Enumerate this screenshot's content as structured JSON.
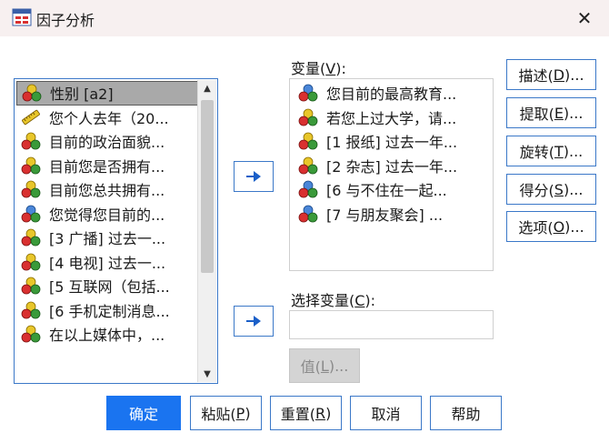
{
  "window": {
    "title": "因子分析",
    "close_symbol": "✕"
  },
  "source_list": {
    "items": [
      {
        "label": "性别 [a2]",
        "icon": "nominal-variable-icon",
        "selected": true
      },
      {
        "label": "您个人去年（20...",
        "icon": "scale-variable-icon",
        "selected": false
      },
      {
        "label": "目前的政治面貌...",
        "icon": "nominal-variable-icon",
        "selected": false
      },
      {
        "label": "目前您是否拥有...",
        "icon": "nominal-variable-icon",
        "selected": false
      },
      {
        "label": "目前您总共拥有...",
        "icon": "nominal-variable-icon",
        "selected": false
      },
      {
        "label": "您觉得您目前的...",
        "icon": "ordinal-variable-icon",
        "selected": false
      },
      {
        "label": "[3 广播]  过去一...",
        "icon": "nominal-variable-icon",
        "selected": false
      },
      {
        "label": "[4 电视]  过去一...",
        "icon": "nominal-variable-icon",
        "selected": false
      },
      {
        "label": "[5 互联网（包括...",
        "icon": "nominal-variable-icon",
        "selected": false
      },
      {
        "label": "[6 手机定制消息...",
        "icon": "nominal-variable-icon",
        "selected": false
      },
      {
        "label": "在以上媒体中，...",
        "icon": "nominal-variable-icon",
        "selected": false
      }
    ]
  },
  "variables": {
    "label_prefix": "变量(",
    "label_key": "V",
    "label_suffix": "):",
    "items": [
      {
        "label": "您目前的最高教育...",
        "icon": "ordinal-variable-icon"
      },
      {
        "label": "若您上过大学，请...",
        "icon": "nominal-variable-icon"
      },
      {
        "label": "[1 报纸]  过去一年...",
        "icon": "nominal-variable-icon"
      },
      {
        "label": "[2 杂志]  过去一年...",
        "icon": "nominal-variable-icon"
      },
      {
        "label": "[6  与不住在一起...",
        "icon": "ordinal-variable-icon"
      },
      {
        "label": "[7  与朋友聚会]  ...",
        "icon": "ordinal-variable-icon"
      }
    ]
  },
  "selection_variable": {
    "label_prefix": "选择变量(",
    "label_key": "C",
    "label_suffix": "):",
    "value": ""
  },
  "value_button": {
    "prefix": "值(",
    "key": "L",
    "suffix": ")..."
  },
  "side_buttons": [
    {
      "prefix": "描述(",
      "key": "D",
      "suffix": ")..."
    },
    {
      "prefix": "提取(",
      "key": "E",
      "suffix": ")..."
    },
    {
      "prefix": "旋转(",
      "key": "T",
      "suffix": ")..."
    },
    {
      "prefix": "得分(",
      "key": "S",
      "suffix": ")..."
    },
    {
      "prefix": "选项(",
      "key": "O",
      "suffix": ")..."
    }
  ],
  "bottom_buttons": [
    {
      "prefix": "确定",
      "key": "",
      "suffix": ""
    },
    {
      "prefix": "粘贴(",
      "key": "P",
      "suffix": ")"
    },
    {
      "prefix": "重置(",
      "key": "R",
      "suffix": ")"
    },
    {
      "prefix": "取消",
      "key": "",
      "suffix": ""
    },
    {
      "prefix": "帮助",
      "key": "",
      "suffix": ""
    }
  ],
  "colors": {
    "accent": "#3b78c8",
    "primary_button": "#1a74f0",
    "selection_bg": "#a9a9a9",
    "titlebar_bg": "#f7f0f0"
  }
}
